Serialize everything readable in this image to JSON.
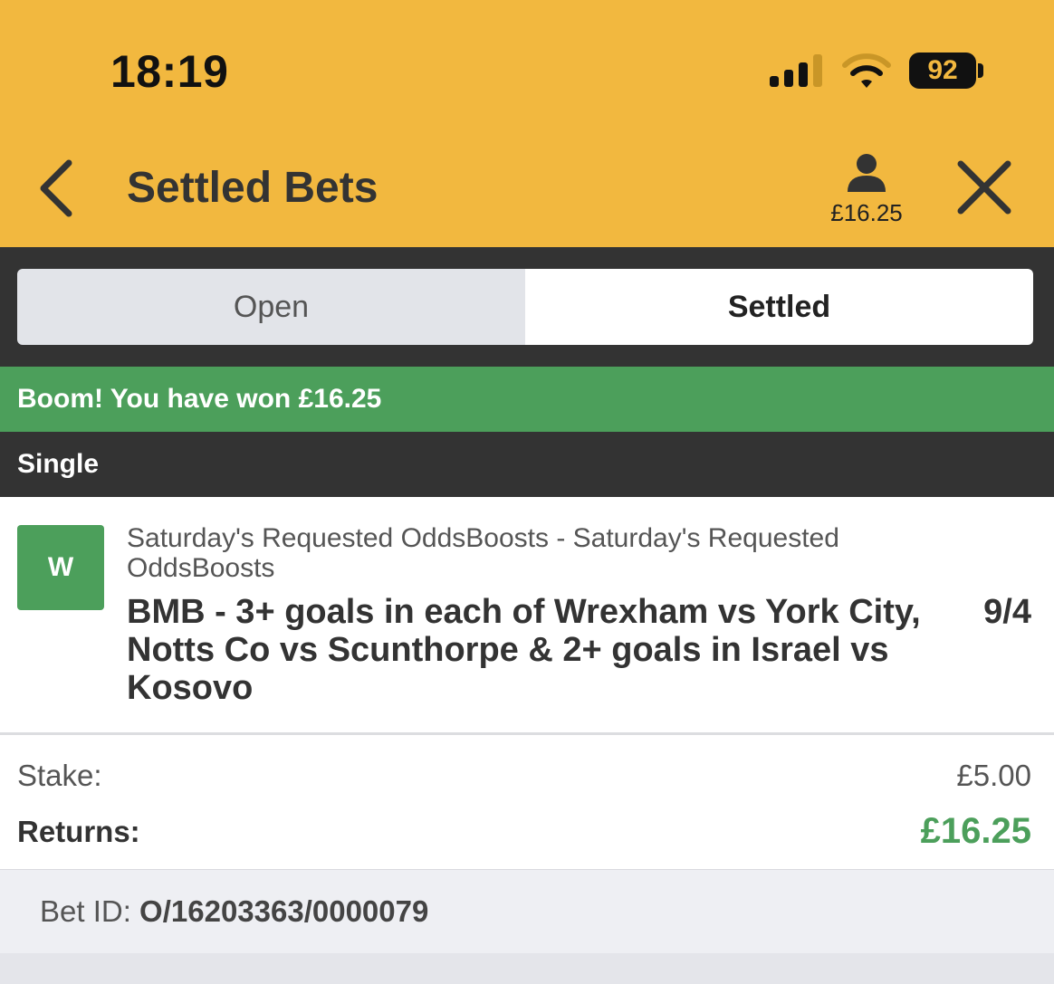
{
  "status_bar": {
    "time": "18:19",
    "battery": "92",
    "signal_icon": "signal-bars-icon",
    "wifi_icon": "wifi-icon"
  },
  "header": {
    "title": "Settled Bets",
    "balance": "£16.25",
    "back_icon": "chevron-left-icon",
    "account_icon": "user-icon",
    "close_icon": "close-icon",
    "background_color": "#f2b83f"
  },
  "tabs": [
    {
      "label": "Open",
      "selected": false
    },
    {
      "label": "Settled",
      "selected": true
    }
  ],
  "banner": {
    "text": "Boom! You have won £16.25",
    "color": "#4c9f5b"
  },
  "bet": {
    "type": "Single",
    "result": "W",
    "event": "Saturday's Requested OddsBoosts - Saturday's Requested OddsBoosts",
    "selection": "BMB - 3+ goals in each of Wrexham vs York City, Notts Co vs Scunthorpe & 2+ goals in Israel vs Kosovo",
    "odds": "9/4",
    "stake_label": "Stake:",
    "stake": "£5.00",
    "returns_label": "Returns:",
    "returns": "£16.25",
    "bet_id_label": "Bet ID:",
    "bet_id": "O/16203363/0000079"
  }
}
